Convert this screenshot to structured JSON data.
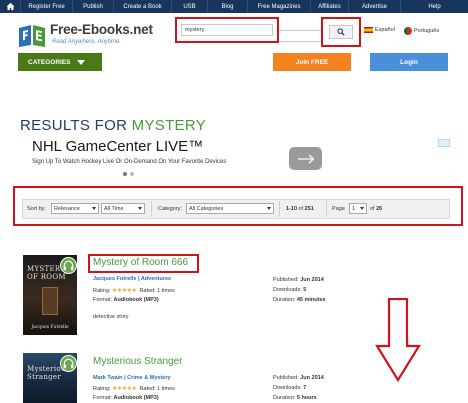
{
  "topnav": {
    "items": [
      "Register Free",
      "Publish",
      "Create a Book",
      "USB",
      "Blog",
      "Free Magazines",
      "Affiliates",
      "Advertise",
      "Help"
    ]
  },
  "logo": {
    "name": "Free-Ebooks",
    "tld": ".net",
    "tagline": "Read Anywhere. Anytime."
  },
  "search": {
    "value": "mystery"
  },
  "languages": [
    {
      "label": "Español",
      "flag": "spain-flag-icon"
    },
    {
      "label": "Português",
      "flag": "portugal-flag-icon"
    }
  ],
  "menu": {
    "categories": "CATEGORIES",
    "join": "Join FREE",
    "login": "Login"
  },
  "results": {
    "prefix": "RESULTS FOR",
    "keyword": "MYSTERY"
  },
  "ad": {
    "title": "NHL GameCenter LIVE™",
    "subtitle": "Sign Up To Watch Hockey Live Or On-Demand On Your Favorite Devices"
  },
  "filters": {
    "sort_label": "Sort by:",
    "sort_value": "Relevance",
    "time_value": "All Time",
    "category_label": "Category:",
    "category_value": "All Categories",
    "range": "1-10",
    "of_word": "of",
    "total": "251",
    "page_label": "Page",
    "page_value": "1",
    "page_of": "of",
    "page_total": "26"
  },
  "books": [
    {
      "title": "Mystery of Room 666",
      "author": "Jacques Futrelle",
      "category": "Adventures",
      "rating_label": "Rating:",
      "stars": "★★★★★",
      "rated": "Rated: 1 times",
      "format_label": "Format:",
      "format": "Audiobook (MP3)",
      "published_label": "Published:",
      "published": "Jun 2014",
      "downloads_label": "Downloads:",
      "downloads": "5",
      "duration_label": "Duration:",
      "duration": "45 minutes",
      "description": "detective story",
      "cover_title": "MYSTERY OF ROOM",
      "cover_author": "Jacques Futrelle"
    },
    {
      "title": "Mysterious Stranger",
      "author": "Mark Twain",
      "category": "Crime & Mystery",
      "rating_label": "Rating:",
      "stars": "★★★★★",
      "rated": "Rated: 1 times",
      "format_label": "Format:",
      "format": "Audiobook (MP3)",
      "published_label": "Published:",
      "published": "Jun 2014",
      "downloads_label": "Downloads:",
      "downloads": "7",
      "duration_label": "Duration:",
      "duration": "5 hours",
      "cover_title": "Mysterious Stranger"
    }
  ],
  "colors": {
    "nav_bg": "#17365d",
    "category_green": "#4a7a18",
    "join_orange": "#f58220",
    "login_blue": "#4a90d9",
    "highlight_red": "#d0141e",
    "title_green": "#4a9a3b"
  }
}
